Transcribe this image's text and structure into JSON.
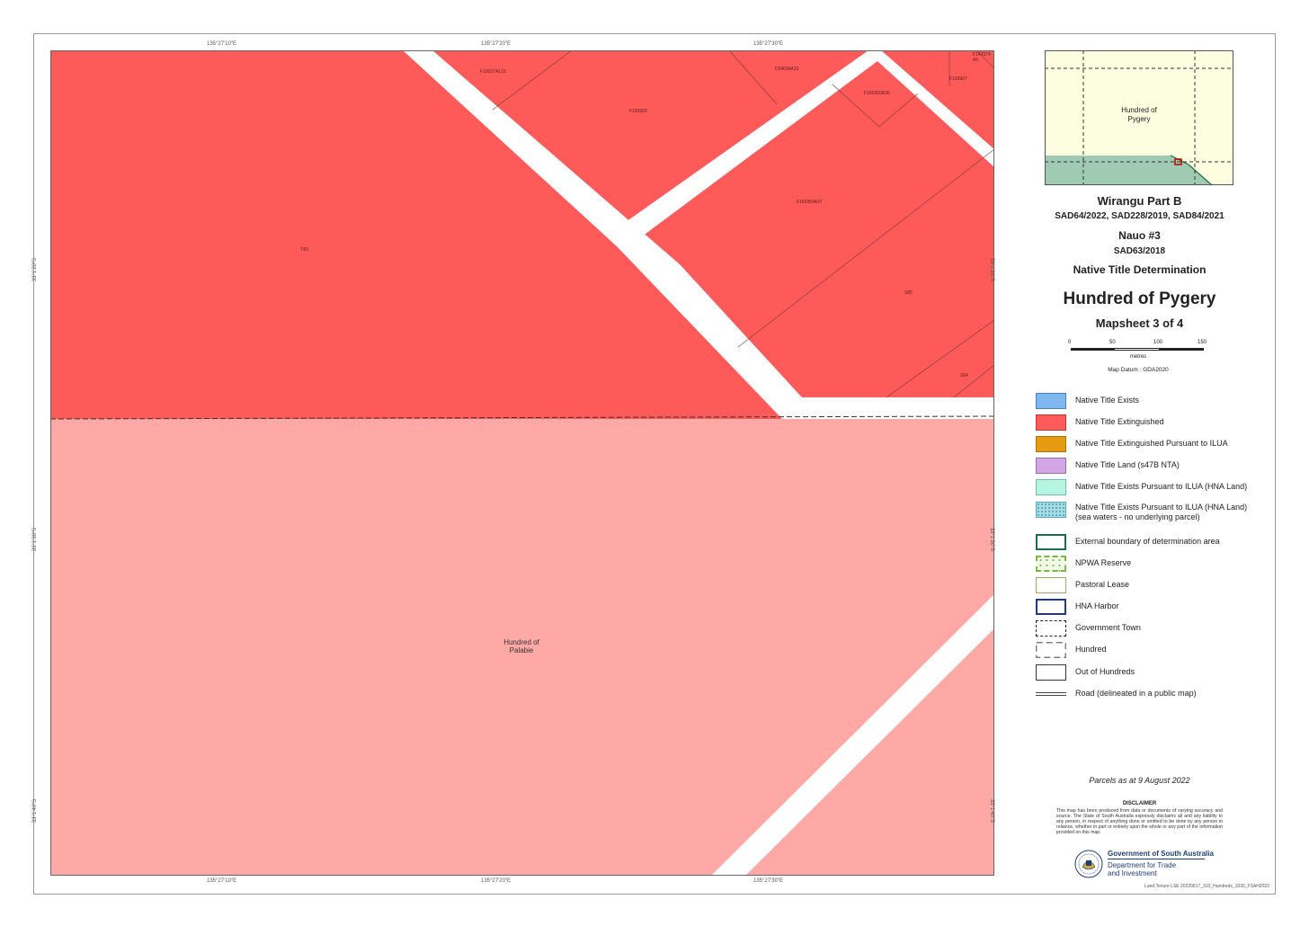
{
  "map": {
    "parcel_labels": {
      "p1": "F19027A123",
      "p2": "D34034A33",
      "p3": "F142974 A5",
      "p4": "F163907",
      "p5": "F183950",
      "p6": "F160350A36",
      "p7": "F160359A37",
      "p8": "T43",
      "p9": "S85",
      "p10": "S84"
    },
    "area_label": "Hundred of\nPalabie",
    "coords": {
      "top": [
        "135°27'10\"E",
        "135°27'20\"E",
        "135°27'30\"E"
      ],
      "bottom": [
        "135°27'10\"E",
        "135°27'20\"E",
        "135°27'30\"E"
      ],
      "left": [
        "33°1'20\"S",
        "33°1'30\"S",
        "33°1'40\"S"
      ],
      "right": [
        "33°1'20\"S",
        "33°1'30\"S",
        "33°1'40\"S"
      ]
    },
    "colors": {
      "extinguished": "#ff5a5a",
      "extinguished_light": "#ffa9a7",
      "road": "#ffffff"
    }
  },
  "inset": {
    "label": "Hundred of\nPygery",
    "colors": {
      "land": "#fdfde0",
      "sea": "#9fcbb3"
    }
  },
  "titles": {
    "claim1": "Wirangu Part B",
    "claim1_ids": "SAD64/2022, SAD228/2019, SAD84/2021",
    "claim2": "Nauo #3",
    "claim2_ids": "SAD63/2018",
    "determination": "Native Title Determination",
    "hundred": "Hundred of Pygery",
    "mapsheet": "Mapsheet 3 of 4"
  },
  "scale": {
    "ticks": [
      "0",
      "50",
      "100",
      "150"
    ],
    "unit": "metres",
    "datum": "Map Datum : GDA2020"
  },
  "legend": [
    {
      "label": "Native Title Exists",
      "icon": "fill-swatch",
      "color": "#7fb8f0"
    },
    {
      "label": "Native Title Extinguished",
      "icon": "fill-swatch",
      "color": "#ff5a5a"
    },
    {
      "label": "Native Title Extinguished Pursuant to ILUA",
      "icon": "fill-swatch",
      "color": "#e59a10"
    },
    {
      "label": "Native Title Land (s47B NTA)",
      "icon": "fill-swatch",
      "color": "#d4a6e6"
    },
    {
      "label": "Native Title Exists Pursuant to ILUA (HNA Land)",
      "icon": "fill-swatch",
      "color": "#b7f5e0"
    },
    {
      "label": "Native Title Exists Pursuant to ILUA (HNA Land)\n(sea waters - no underlying parcel)",
      "icon": "pattern-swatch",
      "color": "#a8dce6"
    },
    {
      "label": "External boundary of determination area",
      "icon": "outline-swatch",
      "color": "#1c6b4a"
    },
    {
      "label": "NPWA Reserve",
      "icon": "reserve-swatch",
      "color": "#7ab648"
    },
    {
      "label": "Pastoral Lease",
      "icon": "outline-swatch",
      "color": "#b39b6b"
    },
    {
      "label": "HNA Harbor",
      "icon": "outline-swatch",
      "color": "#23397a"
    },
    {
      "label": "Government Town",
      "icon": "dashed-swatch",
      "color": "#222222"
    },
    {
      "label": "Hundred",
      "icon": "longdash-swatch",
      "color": "#666666"
    },
    {
      "label": "Out of Hundreds",
      "icon": "outline-swatch",
      "color": "#333333"
    },
    {
      "label": "Road (delineated in a public map)",
      "icon": "road-line",
      "color": "#444444"
    }
  ],
  "footer": {
    "parcels_date": "Parcels as at 9 August 2022",
    "disclaimer_title": "DISCLAIMER",
    "disclaimer": "This map has been produced from data or documents of varying accuracy and source. The State of South Australia expressly disclaims all and any liability to any person, in respect of anything done or omitted to be done by any person in reliance, whether in part or entirely upon the whole or any part of the information provided on this map.",
    "gov_name": "Government of South Australia",
    "gov_dept": "Department for Trade\nand Investment",
    "ref": "Land Tenure LSE 20220817_310_Hundreds_1030_FSAH2022"
  }
}
